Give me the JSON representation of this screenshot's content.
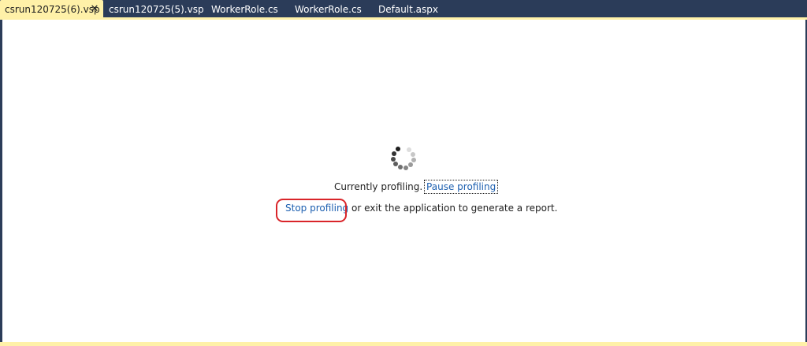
{
  "tabs": [
    {
      "label": "csrun120725(6).vsp",
      "active": true,
      "close_glyph": "✕"
    },
    {
      "label": "csrun120725(5).vsp",
      "active": false
    },
    {
      "label": "WorkerRole.cs",
      "active": false
    },
    {
      "label": "WorkerRole.cs",
      "active": false
    },
    {
      "label": "Default.aspx",
      "active": false
    }
  ],
  "main": {
    "status_text": "Currently profiling.",
    "pause_link": "Pause profiling",
    "stop_link": "Stop profiling",
    "stop_suffix": " or exit the application to generate a report."
  },
  "colors": {
    "chrome": "#2b3c59",
    "active_tab": "#fff1a8",
    "link": "#1c5fb0",
    "highlight": "#d9252a"
  },
  "icons": {
    "spinner": "loading-spinner-icon",
    "close": "close-icon"
  }
}
